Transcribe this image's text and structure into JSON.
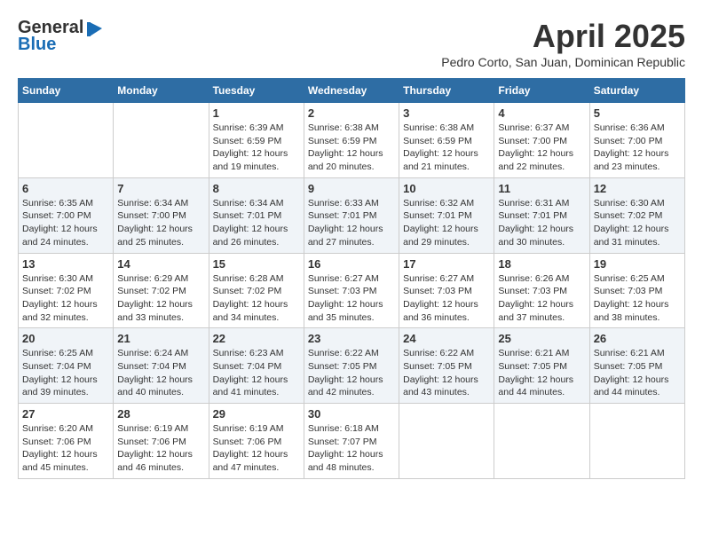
{
  "header": {
    "logo_general": "General",
    "logo_blue": "Blue",
    "month_title": "April 2025",
    "location": "Pedro Corto, San Juan, Dominican Republic"
  },
  "weekdays": [
    "Sunday",
    "Monday",
    "Tuesday",
    "Wednesday",
    "Thursday",
    "Friday",
    "Saturday"
  ],
  "weeks": [
    [
      {
        "day": "",
        "info": ""
      },
      {
        "day": "",
        "info": ""
      },
      {
        "day": "1",
        "info": "Sunrise: 6:39 AM\nSunset: 6:59 PM\nDaylight: 12 hours\nand 19 minutes."
      },
      {
        "day": "2",
        "info": "Sunrise: 6:38 AM\nSunset: 6:59 PM\nDaylight: 12 hours\nand 20 minutes."
      },
      {
        "day": "3",
        "info": "Sunrise: 6:38 AM\nSunset: 6:59 PM\nDaylight: 12 hours\nand 21 minutes."
      },
      {
        "day": "4",
        "info": "Sunrise: 6:37 AM\nSunset: 7:00 PM\nDaylight: 12 hours\nand 22 minutes."
      },
      {
        "day": "5",
        "info": "Sunrise: 6:36 AM\nSunset: 7:00 PM\nDaylight: 12 hours\nand 23 minutes."
      }
    ],
    [
      {
        "day": "6",
        "info": "Sunrise: 6:35 AM\nSunset: 7:00 PM\nDaylight: 12 hours\nand 24 minutes."
      },
      {
        "day": "7",
        "info": "Sunrise: 6:34 AM\nSunset: 7:00 PM\nDaylight: 12 hours\nand 25 minutes."
      },
      {
        "day": "8",
        "info": "Sunrise: 6:34 AM\nSunset: 7:01 PM\nDaylight: 12 hours\nand 26 minutes."
      },
      {
        "day": "9",
        "info": "Sunrise: 6:33 AM\nSunset: 7:01 PM\nDaylight: 12 hours\nand 27 minutes."
      },
      {
        "day": "10",
        "info": "Sunrise: 6:32 AM\nSunset: 7:01 PM\nDaylight: 12 hours\nand 29 minutes."
      },
      {
        "day": "11",
        "info": "Sunrise: 6:31 AM\nSunset: 7:01 PM\nDaylight: 12 hours\nand 30 minutes."
      },
      {
        "day": "12",
        "info": "Sunrise: 6:30 AM\nSunset: 7:02 PM\nDaylight: 12 hours\nand 31 minutes."
      }
    ],
    [
      {
        "day": "13",
        "info": "Sunrise: 6:30 AM\nSunset: 7:02 PM\nDaylight: 12 hours\nand 32 minutes."
      },
      {
        "day": "14",
        "info": "Sunrise: 6:29 AM\nSunset: 7:02 PM\nDaylight: 12 hours\nand 33 minutes."
      },
      {
        "day": "15",
        "info": "Sunrise: 6:28 AM\nSunset: 7:02 PM\nDaylight: 12 hours\nand 34 minutes."
      },
      {
        "day": "16",
        "info": "Sunrise: 6:27 AM\nSunset: 7:03 PM\nDaylight: 12 hours\nand 35 minutes."
      },
      {
        "day": "17",
        "info": "Sunrise: 6:27 AM\nSunset: 7:03 PM\nDaylight: 12 hours\nand 36 minutes."
      },
      {
        "day": "18",
        "info": "Sunrise: 6:26 AM\nSunset: 7:03 PM\nDaylight: 12 hours\nand 37 minutes."
      },
      {
        "day": "19",
        "info": "Sunrise: 6:25 AM\nSunset: 7:03 PM\nDaylight: 12 hours\nand 38 minutes."
      }
    ],
    [
      {
        "day": "20",
        "info": "Sunrise: 6:25 AM\nSunset: 7:04 PM\nDaylight: 12 hours\nand 39 minutes."
      },
      {
        "day": "21",
        "info": "Sunrise: 6:24 AM\nSunset: 7:04 PM\nDaylight: 12 hours\nand 40 minutes."
      },
      {
        "day": "22",
        "info": "Sunrise: 6:23 AM\nSunset: 7:04 PM\nDaylight: 12 hours\nand 41 minutes."
      },
      {
        "day": "23",
        "info": "Sunrise: 6:22 AM\nSunset: 7:05 PM\nDaylight: 12 hours\nand 42 minutes."
      },
      {
        "day": "24",
        "info": "Sunrise: 6:22 AM\nSunset: 7:05 PM\nDaylight: 12 hours\nand 43 minutes."
      },
      {
        "day": "25",
        "info": "Sunrise: 6:21 AM\nSunset: 7:05 PM\nDaylight: 12 hours\nand 44 minutes."
      },
      {
        "day": "26",
        "info": "Sunrise: 6:21 AM\nSunset: 7:05 PM\nDaylight: 12 hours\nand 44 minutes."
      }
    ],
    [
      {
        "day": "27",
        "info": "Sunrise: 6:20 AM\nSunset: 7:06 PM\nDaylight: 12 hours\nand 45 minutes."
      },
      {
        "day": "28",
        "info": "Sunrise: 6:19 AM\nSunset: 7:06 PM\nDaylight: 12 hours\nand 46 minutes."
      },
      {
        "day": "29",
        "info": "Sunrise: 6:19 AM\nSunset: 7:06 PM\nDaylight: 12 hours\nand 47 minutes."
      },
      {
        "day": "30",
        "info": "Sunrise: 6:18 AM\nSunset: 7:07 PM\nDaylight: 12 hours\nand 48 minutes."
      },
      {
        "day": "",
        "info": ""
      },
      {
        "day": "",
        "info": ""
      },
      {
        "day": "",
        "info": ""
      }
    ]
  ]
}
